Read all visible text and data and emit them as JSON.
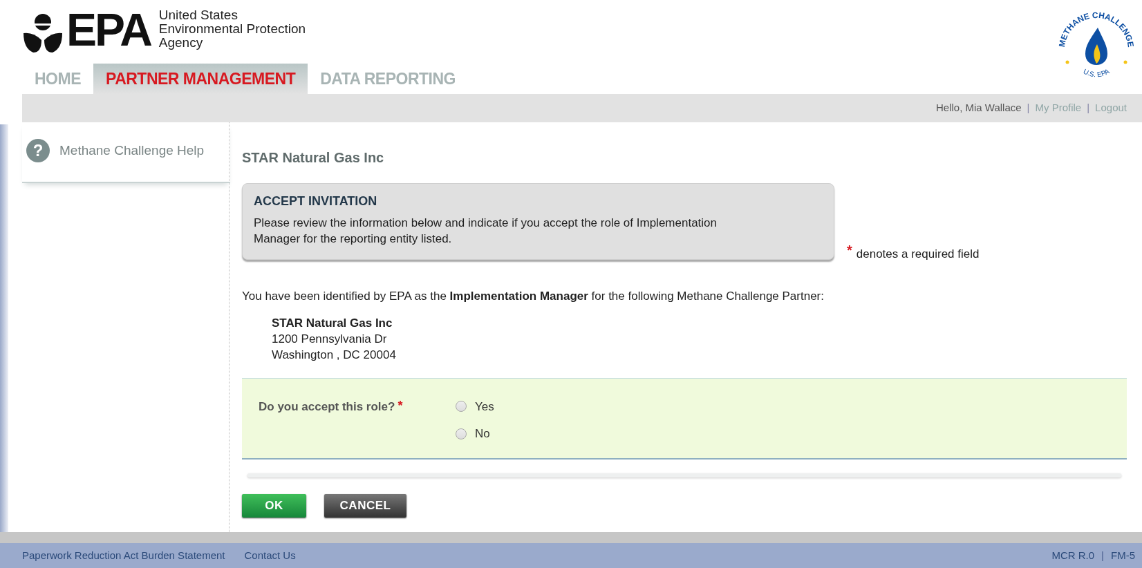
{
  "header": {
    "logo_text": "EPA",
    "agency_lines": [
      "United States",
      "Environmental Protection",
      "Agency"
    ],
    "badge": {
      "top_text": "METHANE CHALLENGE",
      "bottom_text": "U.S. EPA"
    }
  },
  "tabs": [
    {
      "label": "HOME",
      "selected": false
    },
    {
      "label": "PARTNER MANAGEMENT",
      "selected": true
    },
    {
      "label": "DATA REPORTING",
      "selected": false
    }
  ],
  "user_bar": {
    "greeting": "Hello, Mia Wallace",
    "separator_1": "|",
    "profile_link": "My Profile",
    "separator_2": "|",
    "logout_link": "Logout"
  },
  "sidebar": {
    "help_icon": "?",
    "help_link": "Methane Challenge Help"
  },
  "main": {
    "title": "STAR Natural Gas Inc",
    "notice": {
      "heading": "ACCEPT INVITATION",
      "text": "Please review the information below and indicate if you accept the role of Implementation Manager for the reporting entity listed."
    },
    "required_mark": "*",
    "required_note": "denotes a required field",
    "intro": "You have been identified by EPA as the **Implementation Manager** for the following Methane Challenge Partner:",
    "address": {
      "name": "STAR Natural Gas Inc",
      "street": "1200 Pennsylvania Dr",
      "city_line": "Washington , DC 20004"
    },
    "question": {
      "label": "Do you accept this role?",
      "required_mark": "*",
      "options": [
        {
          "label": "Yes",
          "checked": false
        },
        {
          "label": "No",
          "checked": false
        }
      ]
    },
    "buttons": [
      {
        "label": "OK",
        "kind": "primary"
      },
      {
        "label": "CANCEL",
        "kind": "secondary"
      }
    ]
  },
  "footer": {
    "links": [
      "Paperwork Reduction Act Burden Statement",
      "Contact Us"
    ],
    "version": "MCR R.0",
    "separator": "|",
    "page_code": "FM-5"
  }
}
